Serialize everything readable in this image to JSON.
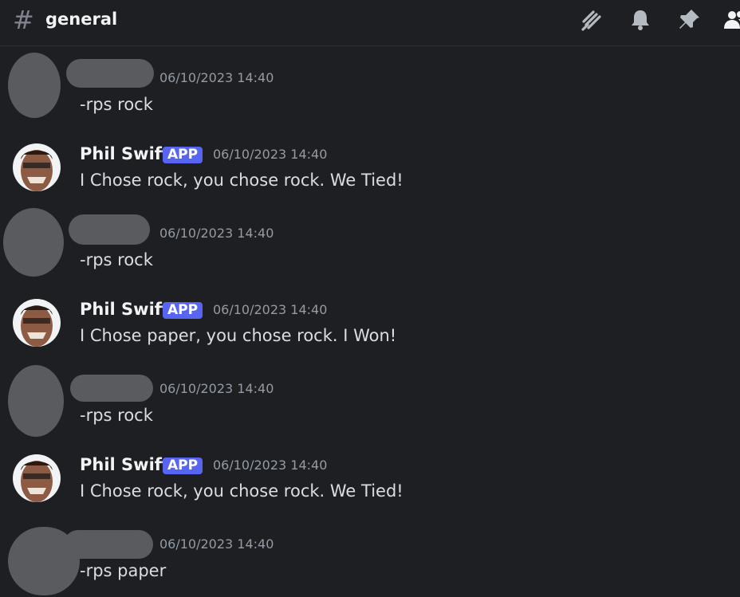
{
  "header": {
    "hash_symbol": "#",
    "channel_name": "general",
    "icons": [
      "threads-icon",
      "notification-bell-icon",
      "pin-icon",
      "member-list-icon"
    ]
  },
  "messages": [
    {
      "author": "",
      "redacted": true,
      "timestamp": "06/10/2023 14:40",
      "text": "-rps rock"
    },
    {
      "author": "Phil Swift",
      "badge": "APP",
      "timestamp": "06/10/2023 14:40",
      "text": "I Chose rock, you chose rock. We Tied!"
    },
    {
      "author": "",
      "redacted": true,
      "timestamp": "06/10/2023 14:40",
      "text": "-rps rock"
    },
    {
      "author": "Phil Swift",
      "badge": "APP",
      "timestamp": "06/10/2023 14:40",
      "text": "I Chose paper, you chose rock. I Won!"
    },
    {
      "author": "",
      "redacted": true,
      "timestamp": "06/10/2023 14:40",
      "text": "-rps rock"
    },
    {
      "author": "Phil Swift",
      "badge": "APP",
      "timestamp": "06/10/2023 14:40",
      "text": "I Chose rock, you chose rock. We Tied!"
    },
    {
      "author": "",
      "redacted": true,
      "timestamp": "06/10/2023 14:40",
      "text": "-rps paper"
    }
  ],
  "colors": {
    "background": "#1e1f22",
    "badge": "#5865f2",
    "timestamp": "#949ba4",
    "redaction": "#5a5b5e"
  }
}
